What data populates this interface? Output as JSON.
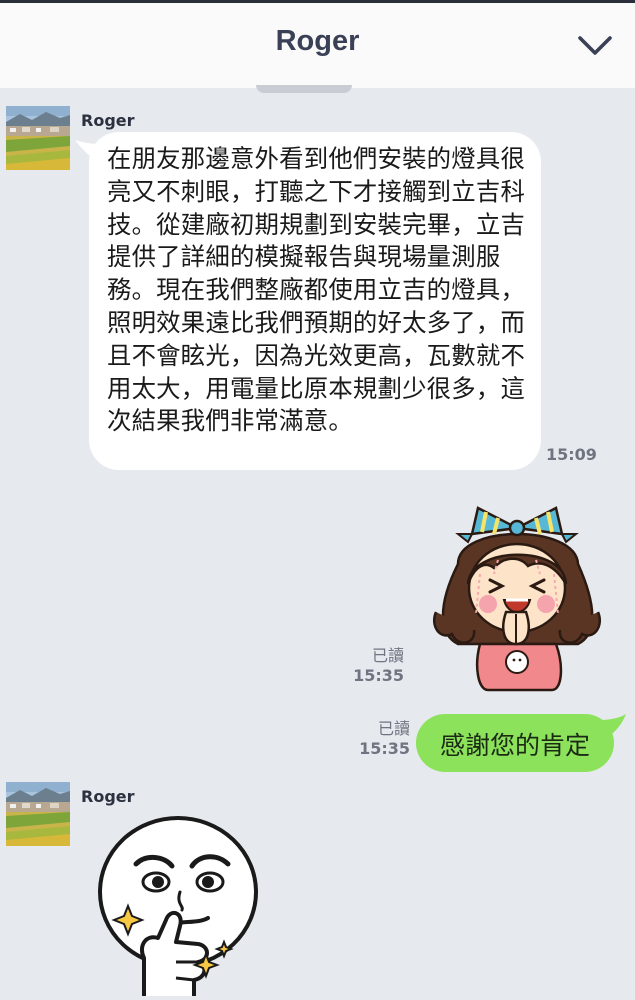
{
  "header": {
    "title": "Roger",
    "collapse_icon": "chevron-down-icon"
  },
  "messages": {
    "incoming_1": {
      "sender": "Roger",
      "text": "在朋友那邊意外看到他們安裝的燈具很亮又不刺眼，打聽之下才接觸到立吉科技。從建廠初期規劃到安裝完畢，立吉提供了詳細的模擬報告與現場量測服務。現在我們整廠都使用立吉的燈具，照明效果遠比我們預期的好太多了，而且不會眩光，因為光效更高，瓦數就不用太大，用電量比原本規劃少很多，這次結果我們非常滿意。",
      "time": "15:09"
    },
    "outgoing_sticker": {
      "read": "已讀",
      "time": "15:35",
      "sticker": "girl-thanks-sticker"
    },
    "outgoing_text": {
      "read": "已讀",
      "time": "15:35",
      "text": "感謝您的肯定"
    },
    "incoming_2": {
      "sender": "Roger",
      "sticker": "thumbs-up-face-sticker"
    }
  },
  "colors": {
    "background": "#e6e9ee",
    "incoming_bubble": "#ffffff",
    "outgoing_bubble": "#8ce25b",
    "header": "#fafafa",
    "title": "#3a4055"
  }
}
